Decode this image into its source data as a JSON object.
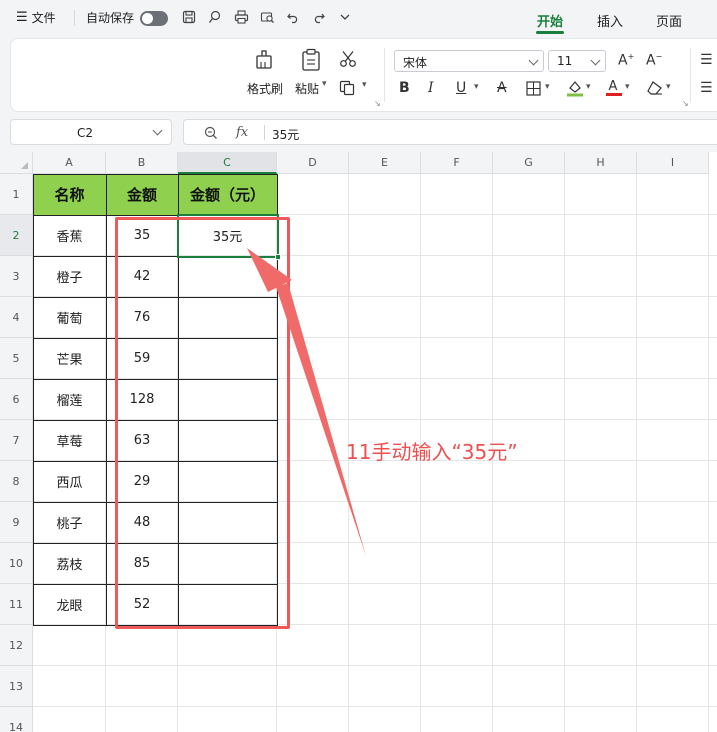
{
  "topbar": {
    "menu_label": "文件",
    "autosave_label": "自动保存",
    "tabs": [
      {
        "label": "开始",
        "active": true
      },
      {
        "label": "插入",
        "active": false
      },
      {
        "label": "页面",
        "active": false
      }
    ],
    "quick_icons": [
      "save-icon",
      "export-icon",
      "print-icon",
      "print-preview-icon",
      "undo-icon",
      "redo-icon",
      "more-icon"
    ]
  },
  "ribbon": {
    "format_painter_label": "格式刷",
    "paste_label": "粘贴",
    "font_name": "宋体",
    "font_size": "11",
    "accent_color": "#1a7f3c",
    "highlight_color": "#7ac142",
    "font_color": "#e02020"
  },
  "formula_bar": {
    "name_box": "C2",
    "fx_label": "fx",
    "value": "35元"
  },
  "sheet": {
    "columns": [
      "A",
      "B",
      "C",
      "D",
      "E",
      "F",
      "G",
      "H",
      "I"
    ],
    "rows": [
      "1",
      "2",
      "3",
      "4",
      "5",
      "6",
      "7",
      "8",
      "9",
      "10",
      "11",
      "12",
      "13",
      "14"
    ],
    "header": [
      "名称",
      "金额",
      "金额（元）"
    ],
    "data": [
      {
        "name": "香蕉",
        "amount": "35",
        "amount_yuan": "35元"
      },
      {
        "name": "橙子",
        "amount": "42",
        "amount_yuan": ""
      },
      {
        "name": "葡萄",
        "amount": "76",
        "amount_yuan": ""
      },
      {
        "name": "芒果",
        "amount": "59",
        "amount_yuan": ""
      },
      {
        "name": "榴莲",
        "amount": "128",
        "amount_yuan": ""
      },
      {
        "name": "草莓",
        "amount": "63",
        "amount_yuan": ""
      },
      {
        "name": "西瓜",
        "amount": "29",
        "amount_yuan": ""
      },
      {
        "name": "桃子",
        "amount": "48",
        "amount_yuan": ""
      },
      {
        "name": "荔枝",
        "amount": "85",
        "amount_yuan": ""
      },
      {
        "name": "龙眼",
        "amount": "52",
        "amount_yuan": ""
      }
    ],
    "header_fill": "#8fd14f"
  },
  "annotation": {
    "text": "11手动输入“35元”",
    "color": "#ee5a5a"
  }
}
